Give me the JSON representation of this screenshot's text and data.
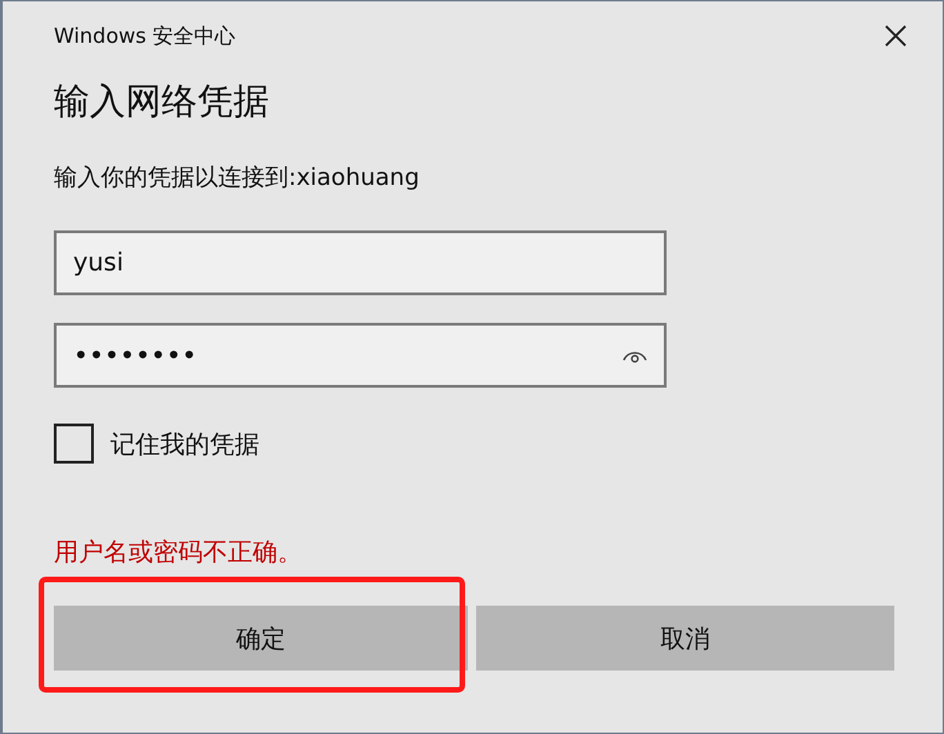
{
  "window": {
    "title": "Windows 安全中心"
  },
  "heading": "输入网络凭据",
  "prompt": "输入你的凭据以连接到:xiaohuang",
  "username": {
    "value": "yusi"
  },
  "password": {
    "value": "••••••••"
  },
  "remember": {
    "label": "记住我的凭据",
    "checked": false
  },
  "error": "用户名或密码不正确。",
  "buttons": [
    {
      "label": "确定",
      "highlighted": true
    },
    {
      "label": "取消",
      "highlighted": false
    }
  ]
}
